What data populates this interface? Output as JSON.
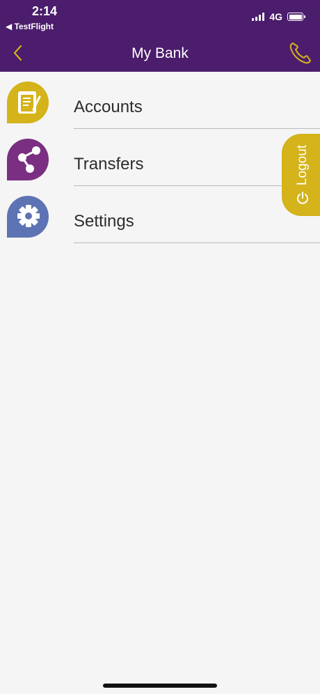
{
  "status_bar": {
    "time": "2:14",
    "back_app": "◀ TestFlight",
    "network": "4G"
  },
  "nav": {
    "title": "My Bank",
    "back_icon": "chevron-left-icon",
    "phone_icon": "phone-icon"
  },
  "menu": {
    "items": [
      {
        "label": "Accounts",
        "icon": "accounts-icon",
        "color": "#d4b31b"
      },
      {
        "label": "Transfers",
        "icon": "transfers-icon",
        "color": "#7b2f82"
      },
      {
        "label": "Settings",
        "icon": "settings-gear-icon",
        "color": "#5e73b3"
      }
    ]
  },
  "logout": {
    "label": "Logout",
    "icon": "power-icon"
  },
  "colors": {
    "brand_purple": "#4b1d6c",
    "accent_gold": "#d4b31b",
    "background": "#f5f5f5"
  }
}
